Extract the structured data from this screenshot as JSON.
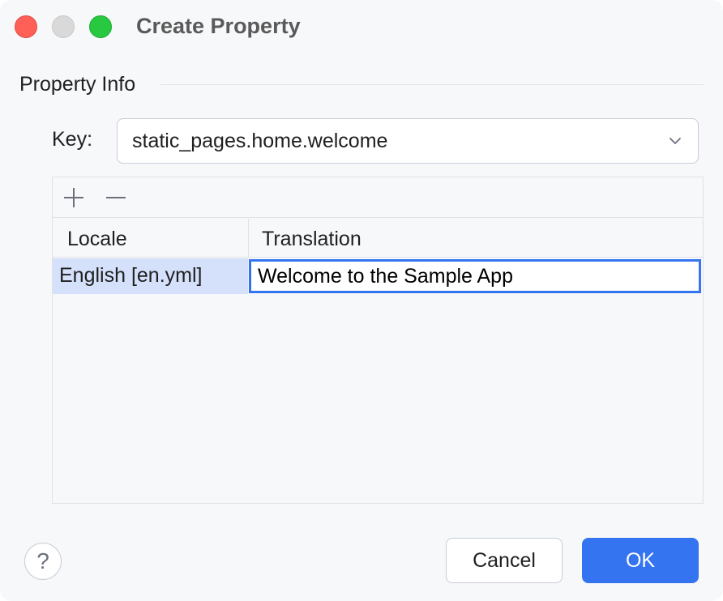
{
  "window": {
    "title": "Create Property"
  },
  "property_info": {
    "group_title": "Property Info",
    "key_label": "Key:",
    "key_value": "static_pages.home.welcome"
  },
  "table": {
    "toolbar": {
      "add_icon": "plus-icon",
      "remove_icon": "minus-icon"
    },
    "columns": [
      "Locale",
      "Translation"
    ],
    "rows": [
      {
        "locale": "English [en.yml]",
        "translation": "Welcome to the Sample App"
      }
    ]
  },
  "footer": {
    "help_label": "?",
    "cancel_label": "Cancel",
    "ok_label": "OK"
  },
  "colors": {
    "accent": "#3574f0",
    "selection": "#d5e1fa",
    "close": "#fe5f57",
    "maximize": "#28c840"
  }
}
